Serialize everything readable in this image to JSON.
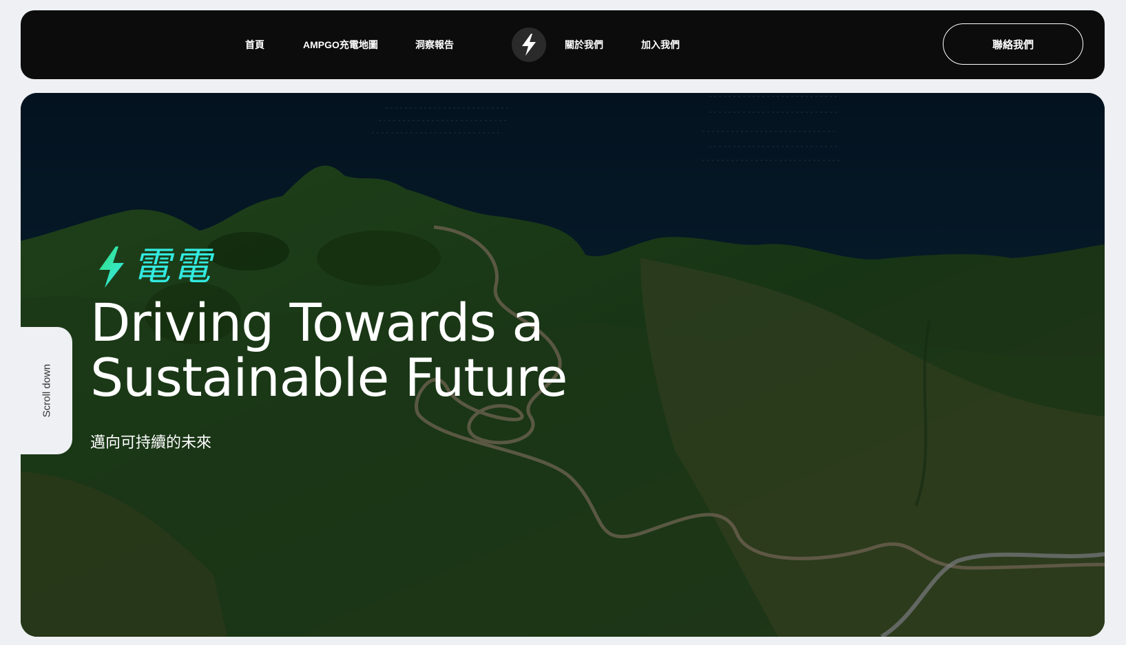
{
  "nav": {
    "left_links": [
      "首頁",
      "AMPGO充電地圖",
      "洞察報告"
    ],
    "right_links": [
      "關於我們",
      "加入我們"
    ],
    "logo_icon": "lightning-bolt-icon",
    "contact_label": "聯絡我們"
  },
  "hero": {
    "brand_text": "電電",
    "brand_icon": "lightning-bolt-icon",
    "title_line1": "Driving Towards a",
    "title_line2": "Sustainable Future",
    "subtitle": "邁向可持續的未來",
    "scroll_label": "Scroll down"
  },
  "colors": {
    "accent": "#33e9e0",
    "bolt_gradient_start": "#30e37a",
    "bolt_gradient_end": "#38e8f0",
    "navbar_bg": "#0c0c0c",
    "page_bg": "#eef0f3"
  }
}
